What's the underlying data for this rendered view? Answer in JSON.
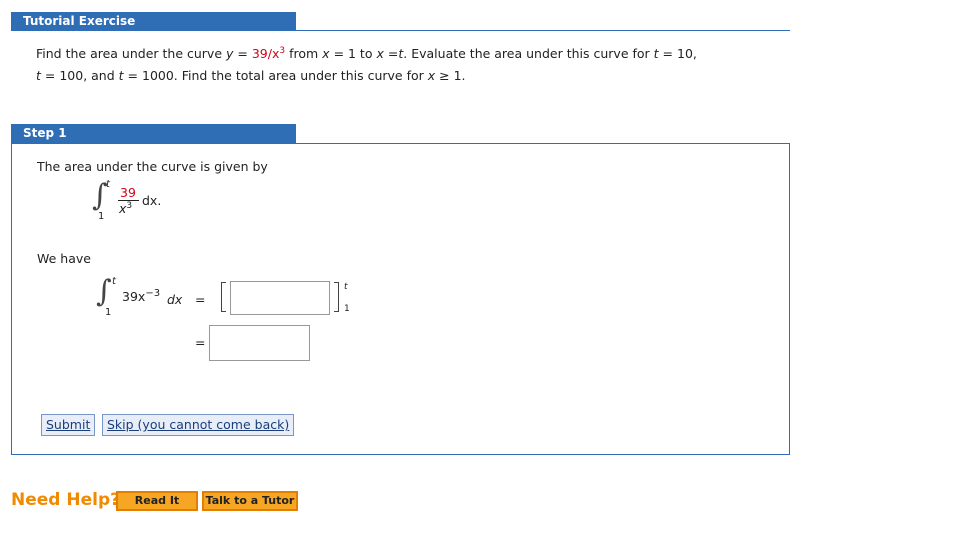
{
  "tutorial": {
    "header": "Tutorial Exercise",
    "q_line1_a": "Find the area under the curve",
    "q_y": "y",
    "q_eq": "=",
    "q_func": "39/x",
    "q_exp": "3",
    "q_from": "from",
    "q_x1": "x",
    "q_eq1": "= 1 to",
    "q_x2": "x",
    "q_eq2": "=",
    "q_t": "t",
    "q_rest1": ". Evaluate the area under this curve for",
    "q_t2": "t",
    "q_eq3": "= 10,",
    "q_t3": "t",
    "q_line2_a": "= 100, and",
    "q_t4": "t",
    "q_line2_b": "= 1000. Find the total area under this curve for",
    "q_x3": "x",
    "q_line2_c": "≥ 1."
  },
  "step": {
    "header": "Step 1",
    "intro": "The area under the curve is given by",
    "integral1": {
      "upper": "t",
      "lower": "1",
      "numerator": "39",
      "denominator": "x",
      "den_exp": "3",
      "dx": "dx."
    },
    "we_have": "We have",
    "integral2": {
      "upper": "t",
      "lower": "1",
      "integrand": "39x",
      "exp": "−3",
      "dx": "dx",
      "eq": "=",
      "bracket_upper": "t",
      "bracket_lower": "1",
      "eq2": "="
    },
    "answer1": {
      "value": ""
    },
    "answer2": {
      "value": ""
    },
    "submit_label": "Submit",
    "skip_label": "Skip (you cannot come back)"
  },
  "help": {
    "label": "Need Help?",
    "read_it": "Read It",
    "talk_to_tutor": "Talk to a Tutor"
  }
}
